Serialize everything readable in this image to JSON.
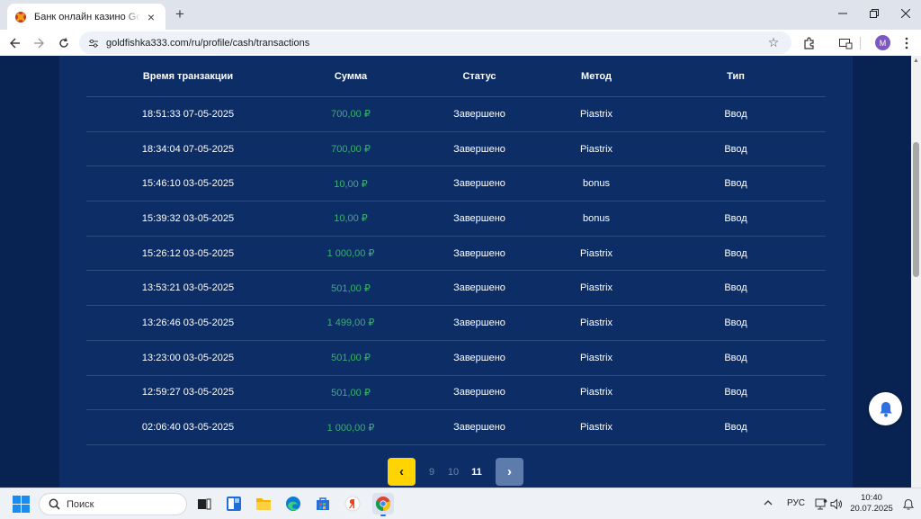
{
  "browser": {
    "tab_title": "Банк онлайн казино GoldFishka",
    "tab_close": "×",
    "new_tab": "+",
    "url": "goldfishka333.com/ru/profile/cash/transactions",
    "profile_initial": "M"
  },
  "table": {
    "headers": [
      "Время транзакции",
      "Сумма",
      "Статус",
      "Метод",
      "Тип"
    ],
    "rows": [
      {
        "time": "18:51:33 07-05-2025",
        "amount": "700,00 ₽",
        "status": "Завершено",
        "method": "Piastrix",
        "type": "Ввод"
      },
      {
        "time": "18:34:04 07-05-2025",
        "amount": "700,00 ₽",
        "status": "Завершено",
        "method": "Piastrix",
        "type": "Ввод"
      },
      {
        "time": "15:46:10 03-05-2025",
        "amount": "10,00 ₽",
        "status": "Завершено",
        "method": "bonus",
        "type": "Ввод"
      },
      {
        "time": "15:39:32 03-05-2025",
        "amount": "10,00 ₽",
        "status": "Завершено",
        "method": "bonus",
        "type": "Ввод"
      },
      {
        "time": "15:26:12 03-05-2025",
        "amount": "1 000,00 ₽",
        "status": "Завершено",
        "method": "Piastrix",
        "type": "Ввод"
      },
      {
        "time": "13:53:21 03-05-2025",
        "amount": "501,00 ₽",
        "status": "Завершено",
        "method": "Piastrix",
        "type": "Ввод"
      },
      {
        "time": "13:26:46 03-05-2025",
        "amount": "1 499,00 ₽",
        "status": "Завершено",
        "method": "Piastrix",
        "type": "Ввод"
      },
      {
        "time": "13:23:00 03-05-2025",
        "amount": "501,00 ₽",
        "status": "Завершено",
        "method": "Piastrix",
        "type": "Ввод"
      },
      {
        "time": "12:59:27 03-05-2025",
        "amount": "501,00 ₽",
        "status": "Завершено",
        "method": "Piastrix",
        "type": "Ввод"
      },
      {
        "time": "02:06:40 03-05-2025",
        "amount": "1 000,00 ₽",
        "status": "Завершено",
        "method": "Piastrix",
        "type": "Ввод"
      }
    ]
  },
  "pagination": {
    "prev": "‹",
    "pages": [
      "9",
      "10",
      "11"
    ],
    "current": "11",
    "next": "›"
  },
  "taskbar": {
    "search_label": "Поиск",
    "language": "РУС",
    "time": "10:40",
    "date": "20.07.2025"
  },
  "colors": {
    "page_bg": "#082352",
    "panel_bg": "#0d2d66",
    "amount_green": "#37b36b",
    "prev_button": "#ffd400",
    "next_button": "#5d7bab"
  }
}
